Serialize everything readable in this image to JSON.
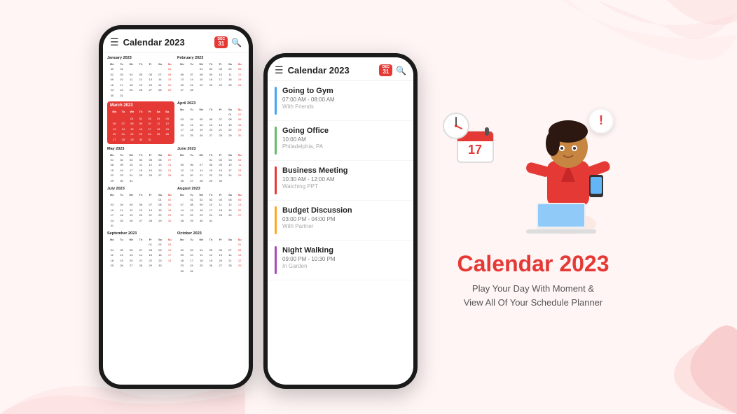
{
  "app": {
    "title": "Calendar 2023",
    "badge_month": "DEC",
    "badge_day": "31"
  },
  "tagline": {
    "title": "Calendar 2023",
    "subtitle_line1": "Play Your Day With Moment &",
    "subtitle_line2": "View All Of Your Schedule Planner"
  },
  "months_left": [
    {
      "name": "January 2023",
      "headers": [
        "Mo",
        "Tu",
        "We",
        "Th",
        "Fr",
        "Sa",
        "Su"
      ],
      "rows": [
        [
          "30",
          "31",
          "",
          "",
          "",
          "",
          "01"
        ],
        [
          "02",
          "03",
          "04",
          "05",
          "06",
          "07",
          "08"
        ],
        [
          "09",
          "10",
          "11",
          "12",
          "13",
          "14",
          "15"
        ],
        [
          "16",
          "17",
          "18",
          "19",
          "20",
          "21",
          "22"
        ],
        [
          "23",
          "24",
          "25",
          "26",
          "27",
          "28",
          "29"
        ],
        [
          "30",
          "31",
          "",
          "",
          "",
          "",
          ""
        ]
      ]
    },
    {
      "name": "February 2023",
      "headers": [
        "Mo",
        "Tu",
        "We",
        "Th",
        "Fr",
        "Sa",
        "Su"
      ],
      "rows": [
        [
          "",
          "",
          "01",
          "02",
          "03",
          "04",
          "05"
        ],
        [
          "06",
          "07",
          "08",
          "09",
          "10",
          "11",
          "12"
        ],
        [
          "13",
          "14",
          "15",
          "16",
          "17",
          "18",
          "19"
        ],
        [
          "20",
          "21",
          "22",
          "23",
          "24",
          "25",
          "26"
        ],
        [
          "27",
          "28",
          "",
          "",
          "",
          "",
          ""
        ]
      ]
    },
    {
      "name": "March 2023",
      "headers": [
        "Mo",
        "Tu",
        "We",
        "Th",
        "Fr",
        "Sa",
        "Su"
      ],
      "rows": [
        [
          "",
          "",
          "01",
          "02",
          "03",
          "04",
          "05"
        ],
        [
          "06",
          "07",
          "08",
          "09",
          "10",
          "11",
          "12"
        ],
        [
          "13",
          "14",
          "15",
          "16",
          "17",
          "18",
          "19"
        ],
        [
          "20",
          "21",
          "22",
          "23",
          "24",
          "25",
          "26"
        ],
        [
          "27",
          "28",
          "29",
          "30",
          "31",
          "",
          ""
        ]
      ]
    },
    {
      "name": "April 2023",
      "headers": [
        "Mo",
        "Tu",
        "We",
        "Th",
        "Fr",
        "Sa",
        "Su"
      ],
      "rows": [
        [
          "",
          "",
          "",
          "",
          "",
          "01",
          "02"
        ],
        [
          "03",
          "04",
          "05",
          "06",
          "07",
          "08",
          "09"
        ],
        [
          "10",
          "11",
          "12",
          "13",
          "14",
          "15",
          "16"
        ],
        [
          "17",
          "18",
          "19",
          "20",
          "21",
          "22",
          "23"
        ],
        [
          "24",
          "25",
          "26",
          "27",
          "28",
          "29",
          "30"
        ]
      ]
    },
    {
      "name": "May 2023",
      "headers": [
        "Mo",
        "Tu",
        "We",
        "Th",
        "Fr",
        "Sa",
        "Su"
      ],
      "rows": [
        [
          "01",
          "02",
          "03",
          "04",
          "05",
          "06",
          "07"
        ],
        [
          "08",
          "09",
          "10",
          "11",
          "12",
          "13",
          "14"
        ],
        [
          "15",
          "16",
          "17",
          "18",
          "19",
          "20",
          "21"
        ],
        [
          "22",
          "23",
          "24",
          "25",
          "26",
          "27",
          "28"
        ],
        [
          "29",
          "30",
          "31",
          "",
          "",
          "",
          ""
        ]
      ]
    },
    {
      "name": "June 2023",
      "headers": [
        "Mo",
        "Tu",
        "We",
        "Th",
        "Fr",
        "Sa",
        "Su"
      ],
      "rows": [
        [
          "",
          "",
          "",
          "01",
          "02",
          "03",
          "04"
        ],
        [
          "05",
          "06",
          "07",
          "08",
          "09",
          "10",
          "11"
        ],
        [
          "12",
          "13",
          "14",
          "15",
          "16",
          "17",
          "18"
        ],
        [
          "19",
          "20",
          "21",
          "22",
          "23",
          "24",
          "25"
        ],
        [
          "26",
          "27",
          "28",
          "29",
          "30",
          "",
          ""
        ]
      ]
    },
    {
      "name": "July 2023",
      "headers": [
        "Mo",
        "Tu",
        "We",
        "Th",
        "Fr",
        "Sa",
        "Su"
      ],
      "rows": [
        [
          "",
          "",
          "",
          "",
          "",
          "01",
          "02"
        ],
        [
          "03",
          "04",
          "05",
          "06",
          "07",
          "08",
          "09"
        ],
        [
          "10",
          "11",
          "12",
          "13",
          "14",
          "15",
          "16"
        ],
        [
          "17",
          "18",
          "19",
          "20",
          "21",
          "22",
          "23"
        ],
        [
          "24",
          "25",
          "26",
          "27",
          "28",
          "29",
          "30"
        ],
        [
          "31",
          "",
          "",
          "",
          "",
          "",
          ""
        ]
      ]
    },
    {
      "name": "August 2023",
      "headers": [
        "Mo",
        "Tu",
        "We",
        "Th",
        "Fr",
        "Sa",
        "Su"
      ],
      "rows": [
        [
          "",
          "01",
          "02",
          "03",
          "04",
          "05",
          "06"
        ],
        [
          "07",
          "08",
          "09",
          "10",
          "11",
          "12",
          "13"
        ],
        [
          "14",
          "15",
          "16",
          "17",
          "18",
          "19",
          "20"
        ],
        [
          "21",
          "22",
          "23",
          "24",
          "25",
          "26",
          "27"
        ],
        [
          "28",
          "29",
          "30",
          "31",
          "",
          "",
          ""
        ]
      ]
    },
    {
      "name": "September 2023",
      "headers": [
        "Mo",
        "Tu",
        "We",
        "Th",
        "Fr",
        "Sa",
        "Su"
      ],
      "rows": [
        [
          "",
          "",
          "",
          "",
          "01",
          "02",
          "03"
        ],
        [
          "04",
          "05",
          "06",
          "07",
          "08",
          "09",
          "10"
        ],
        [
          "11",
          "12",
          "13",
          "14",
          "15",
          "16",
          "17"
        ],
        [
          "18",
          "19",
          "20",
          "21",
          "22",
          "23",
          "24"
        ],
        [
          "25",
          "26",
          "27",
          "28",
          "29",
          "30",
          ""
        ]
      ]
    },
    {
      "name": "October 2023",
      "headers": [
        "Mo",
        "Tu",
        "We",
        "Th",
        "Fr",
        "Sa",
        "Su"
      ],
      "rows": [
        [
          "",
          "",
          "",
          "",
          "",
          "",
          "01"
        ],
        [
          "02",
          "03",
          "04",
          "05",
          "06",
          "07",
          "08"
        ],
        [
          "09",
          "10",
          "11",
          "12",
          "13",
          "14",
          "15"
        ],
        [
          "16",
          "17",
          "18",
          "19",
          "20",
          "21",
          "22"
        ],
        [
          "23",
          "24",
          "25",
          "26",
          "27",
          "28",
          "29"
        ],
        [
          "30",
          "31",
          "",
          "",
          "",
          "",
          ""
        ]
      ]
    }
  ],
  "schedule": [
    {
      "title": "Going to Gym",
      "time": "07:00 AM - 08:00 AM",
      "location": "With Friends",
      "color": "#42a5f5"
    },
    {
      "title": "Going Office",
      "time": "10:00 AM",
      "location": "Philadelphia, PA",
      "color": "#66bb6a"
    },
    {
      "title": "Business Meeting",
      "time": "10:30 AM - 12:00 AM",
      "location": "Watching PPT",
      "color": "#e53935"
    },
    {
      "title": "Budget Discussion",
      "time": "03:00 PM - 04:00 PM",
      "location": "With Partner",
      "color": "#ffa726"
    },
    {
      "title": "Night Walking",
      "time": "09:00 PM - 10:30 PM",
      "location": "In Garden",
      "color": "#ab47bc"
    }
  ]
}
